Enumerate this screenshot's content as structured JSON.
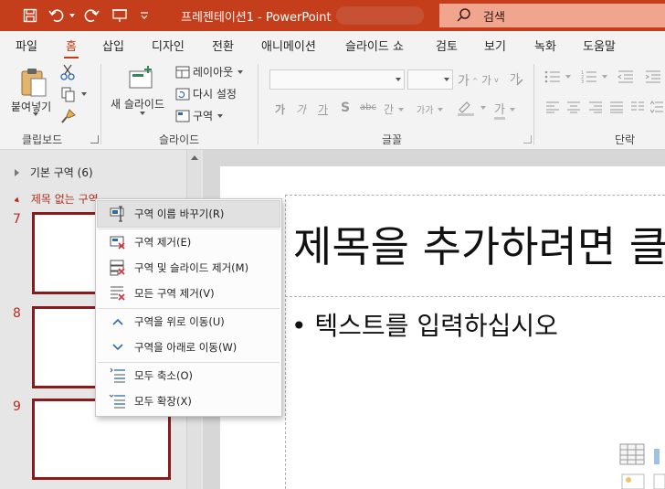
{
  "titlebar": {
    "doc_name": "프레젠테이션1",
    "separator": "-",
    "app_name": "PowerPoint",
    "search_label": "검색"
  },
  "tabs": [
    "파일",
    "홈",
    "삽입",
    "디자인",
    "전환",
    "애니메이션",
    "슬라이드 쇼",
    "검토",
    "보기",
    "녹화",
    "도움말"
  ],
  "active_tab": "홈",
  "ribbon": {
    "clipboard": {
      "paste_label": "붙여넣기",
      "group_label": "클립보드"
    },
    "slides": {
      "new_slide_label": "새 슬라이드",
      "layout_label": "레이아웃",
      "reset_label": "다시 설정",
      "section_label": "구역",
      "group_label": "슬라이드"
    },
    "font": {
      "group_label": "글꼴",
      "font_name": "",
      "font_size": "",
      "grow_label": "가",
      "shrink_label": "가",
      "bold": "가",
      "italic": "가",
      "underline": "가",
      "shadow": "S",
      "strike": "abc",
      "spacing": "간",
      "case": "가가",
      "highlight": "가",
      "font_color": "가"
    },
    "paragraph": {
      "group_label": "단락"
    }
  },
  "left_pane": {
    "section1": {
      "name": "기본 구역",
      "count": "(6)"
    },
    "section2": {
      "name": "제목 없는 구역"
    },
    "slides": [
      {
        "number": "7"
      },
      {
        "number": "8"
      },
      {
        "number": "9"
      }
    ]
  },
  "slide": {
    "title_placeholder": "제목을 추가하려면 클",
    "body_placeholder": "• 텍스트를 입력하십시오"
  },
  "context_menu": {
    "items": [
      {
        "label": "구역 이름 바꾸기(R)",
        "icon": "rename-section-icon"
      },
      {
        "label": "구역 제거(E)",
        "icon": "remove-section-icon"
      },
      {
        "label": "구역 및 슬라이드 제거(M)",
        "icon": "remove-section-slides-icon"
      },
      {
        "label": "모든 구역 제거(V)",
        "icon": "remove-all-sections-icon"
      },
      {
        "label": "구역을 위로 이동(U)",
        "icon": "chevron-up-icon"
      },
      {
        "label": "구역을 아래로 이동(W)",
        "icon": "chevron-down-icon"
      },
      {
        "label": "모두 축소(O)",
        "icon": "collapse-all-icon"
      },
      {
        "label": "모두 확장(X)",
        "icon": "expand-all-icon"
      }
    ]
  },
  "colors": {
    "accent": "#c43e1c",
    "slide_border": "#8b1a1a",
    "section_text": "#b22d1e"
  }
}
